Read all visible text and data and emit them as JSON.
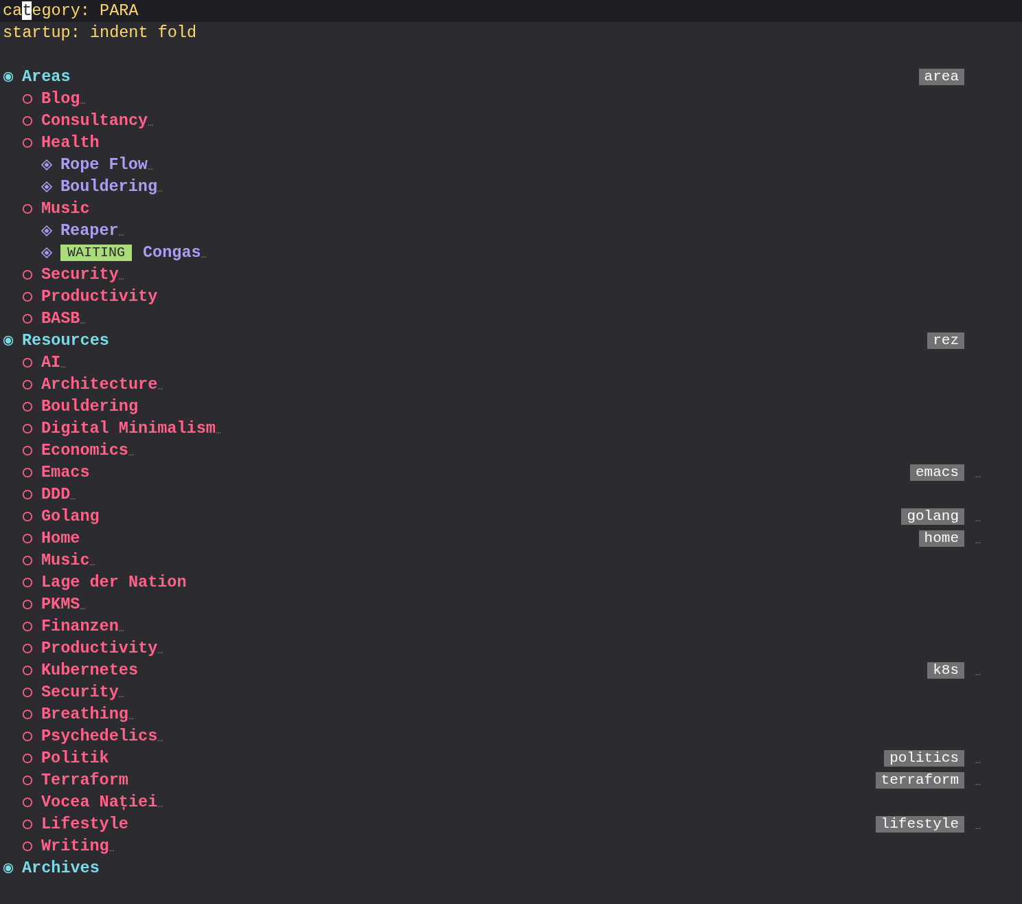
{
  "header": {
    "lines": [
      {
        "before_cursor": "ca",
        "under_cursor": "t",
        "after_cursor": "egory: PARA",
        "current": true
      },
      {
        "before_cursor": "startup: indent fold",
        "current": false
      }
    ]
  },
  "outline": [
    {
      "title": "Areas",
      "tag": "area",
      "children": [
        {
          "title": "Blog",
          "fold_marker": "…"
        },
        {
          "title": "Consultancy",
          "fold_marker": "…"
        },
        {
          "title": "Health",
          "children": [
            {
              "title": "Rope Flow",
              "fold_marker": "…"
            },
            {
              "title": "Bouldering",
              "fold_marker": "…"
            }
          ]
        },
        {
          "title": "Music",
          "children": [
            {
              "title": "Reaper",
              "fold_marker": "…"
            },
            {
              "todo": "WAITING",
              "title": "Congas",
              "fold_marker": "…"
            }
          ]
        },
        {
          "title": "Security",
          "fold_marker": "…"
        },
        {
          "title": "Productivity"
        },
        {
          "title": "BASB",
          "fold_marker": "…"
        }
      ]
    },
    {
      "title": "Resources",
      "tag": "rez",
      "children": [
        {
          "title": "AI",
          "fold_marker": "…"
        },
        {
          "title": "Architecture",
          "fold_marker": "…"
        },
        {
          "title": "Bouldering"
        },
        {
          "title": "Digital Minimalism",
          "fold_marker": "…"
        },
        {
          "title": "Economics",
          "fold_marker": "…"
        },
        {
          "title": "Emacs",
          "tag": "emacs",
          "fold_marker": "…"
        },
        {
          "title": "DDD",
          "fold_marker": "…"
        },
        {
          "title": "Golang",
          "tag": "golang",
          "fold_marker": "…"
        },
        {
          "title": "Home",
          "tag": "home",
          "fold_marker": "…"
        },
        {
          "title": "Music",
          "fold_marker": "…"
        },
        {
          "title": "Lage der Nation"
        },
        {
          "title": "PKMS",
          "fold_marker": "…"
        },
        {
          "title": "Finanzen",
          "fold_marker": "…"
        },
        {
          "title": "Productivity",
          "fold_marker": "…"
        },
        {
          "title": "Kubernetes",
          "tag": "k8s",
          "fold_marker": "…"
        },
        {
          "title": "Security",
          "fold_marker": "…"
        },
        {
          "title": "Breathing",
          "fold_marker": "…"
        },
        {
          "title": "Psychedelics",
          "fold_marker": "…"
        },
        {
          "title": "Politik",
          "tag": "politics",
          "fold_marker": "…"
        },
        {
          "title": "Terraform",
          "tag": "terraform",
          "fold_marker": "…"
        },
        {
          "title": "Vocea Nației",
          "fold_marker": "…"
        },
        {
          "title": "Lifestyle",
          "tag": "lifestyle",
          "fold_marker": "…"
        },
        {
          "title": "Writing",
          "fold_marker": "…"
        }
      ]
    },
    {
      "title": "Archives"
    }
  ]
}
